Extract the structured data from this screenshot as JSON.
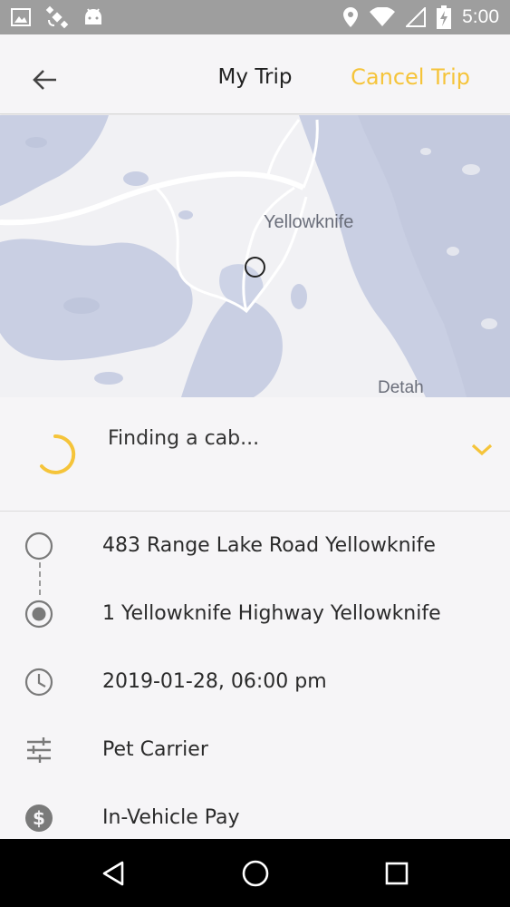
{
  "status_bar": {
    "time": "5:00",
    "icons": [
      "image-icon",
      "satellite-icon",
      "android-icon",
      "location-pin-icon",
      "wifi-icon",
      "no-signal-icon",
      "battery-charging-icon"
    ]
  },
  "toolbar": {
    "title": "My Trip",
    "cancel_label": "Cancel Trip",
    "back_icon": "arrow-left-icon"
  },
  "map": {
    "labels": {
      "city": "Yellowknife",
      "town": "Detah"
    },
    "marker": "pickup-location-marker"
  },
  "status_panel": {
    "message": "Finding a cab...",
    "spinner": "loading-spinner",
    "expand_icon": "chevron-down-icon"
  },
  "trip": {
    "pickup": "483 Range Lake Road Yellowknife",
    "dropoff": "1 Yellowknife Highway Yellowknife",
    "datetime": "2019-01-28, 06:00 pm",
    "options": "Pet Carrier",
    "payment": "In-Vehicle Pay"
  },
  "nav_bar": {
    "buttons": [
      "back-triangle-icon",
      "home-circle-icon",
      "recents-square-icon"
    ]
  },
  "colors": {
    "accent": "#f5c43a",
    "status_bar": "#9e9e9e",
    "background": "#f6f5f7",
    "water": "#c9cfe3",
    "land": "#f1f1f4"
  }
}
